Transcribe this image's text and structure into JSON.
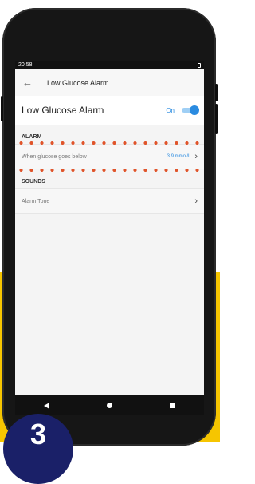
{
  "status_bar": {
    "time": "20:58"
  },
  "app_bar": {
    "title": "Low Glucose Alarm",
    "back_icon": "arrow-left-icon"
  },
  "toggle": {
    "label": "Low Glucose Alarm",
    "state_text": "On",
    "enabled": true
  },
  "alarm_section": {
    "header": "ALARM",
    "threshold_label": "When glucose goes below",
    "threshold_value": "3.9 mmol/L"
  },
  "sounds_section": {
    "header": "SOUNDS",
    "tone_label": "Alarm Tone"
  },
  "step_badge": {
    "number": "3"
  },
  "colors": {
    "accent": "#2a8be0",
    "highlight_dots": "#e0542a",
    "badge": "#1a2068",
    "background_band": "#f6c500"
  }
}
